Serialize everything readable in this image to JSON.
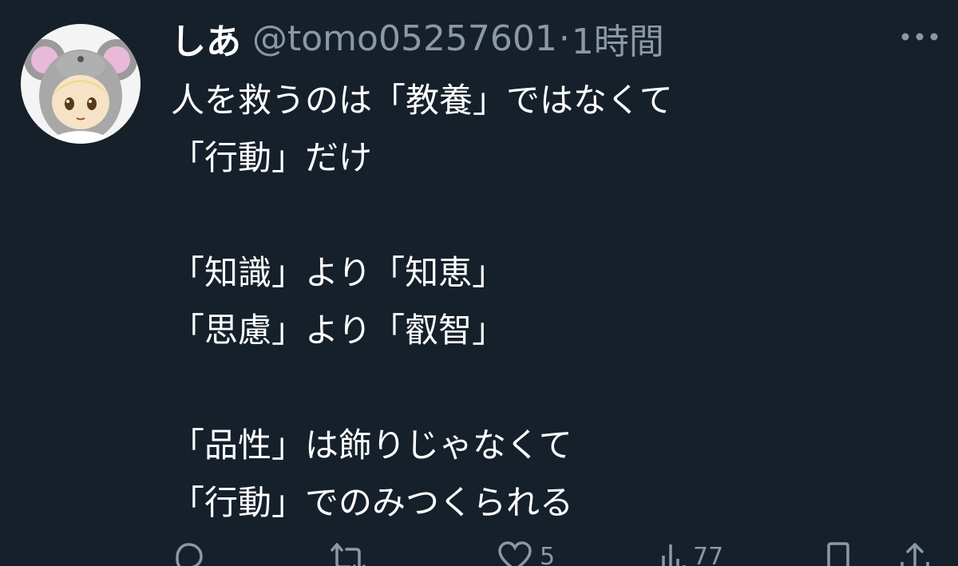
{
  "user": {
    "display_name": "しあ",
    "handle": "@tomo05257601",
    "separator": "·",
    "time": "1時間",
    "avatar": "mouse-avatar"
  },
  "tweet": {
    "lines": [
      "人を救うのは「教養」ではなくて",
      "「行動」だけ",
      "",
      "「知識」より「知恵」",
      "「思慮」より「叡智」",
      "",
      "「品性」は飾りじゃなくて",
      "「行動」でのみつくられる"
    ]
  },
  "actions": {
    "reply": {
      "icon": "reply-icon",
      "count": ""
    },
    "retweet": {
      "icon": "retweet-icon",
      "count": ""
    },
    "like": {
      "icon": "heart-icon",
      "count": "5"
    },
    "views": {
      "icon": "views-icon",
      "count": "77"
    },
    "bookmark": {
      "icon": "bookmark-icon",
      "count": ""
    },
    "share": {
      "icon": "share-icon",
      "count": ""
    }
  },
  "colors": {
    "background": "#15202b",
    "secondary_text": "#8b98a5",
    "primary_text": "#ffffff"
  }
}
